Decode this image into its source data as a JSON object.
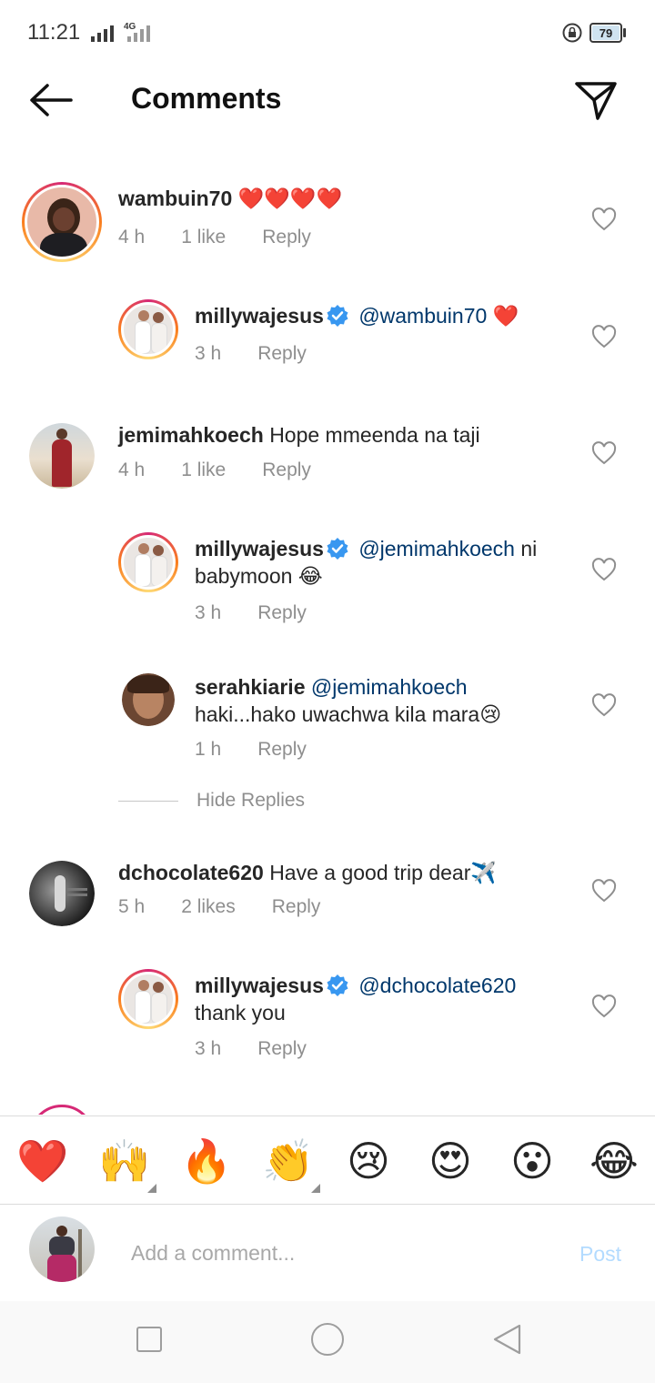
{
  "status_bar": {
    "time": "11:21",
    "network": "4G",
    "battery": "79",
    "icons": [
      "signal-icon",
      "signal-4g-icon",
      "rotation-lock-icon",
      "battery-icon"
    ]
  },
  "header": {
    "title": "Comments",
    "back_icon": "arrow-left-icon",
    "share_icon": "paper-plane-icon"
  },
  "comments": [
    {
      "username": "wambuin70",
      "text": "❤️❤️❤️❤️",
      "mention": "",
      "time": "4 h",
      "likes": "1 like",
      "reply_label": "Reply",
      "verified": false,
      "is_reply": false
    },
    {
      "username": "millywajesus",
      "mention": "@wambuin70",
      "text": "❤️",
      "time": "3 h",
      "likes": "",
      "reply_label": "Reply",
      "verified": true,
      "is_reply": true
    },
    {
      "username": "jemimahkoech",
      "text": "Hope mmeenda na taji",
      "mention": "",
      "time": "4 h",
      "likes": "1 like",
      "reply_label": "Reply",
      "verified": false,
      "is_reply": false
    },
    {
      "username": "millywajesus",
      "mention": "@jemimahkoech",
      "text": "ni babymoon 😂",
      "time": "3 h",
      "likes": "",
      "reply_label": "Reply",
      "verified": true,
      "is_reply": true
    },
    {
      "username": "serahkiarie",
      "mention": "@jemimahkoech",
      "text": "haki...hako uwachwa kila mara😢",
      "time": "1 h",
      "likes": "",
      "reply_label": "Reply",
      "verified": false,
      "is_reply": true
    },
    {
      "username": "dchocolate620",
      "text": "Have a good trip dear✈️",
      "mention": "",
      "time": "5 h",
      "likes": "2 likes",
      "reply_label": "Reply",
      "verified": false,
      "is_reply": false
    },
    {
      "username": "millywajesus",
      "mention": "@dchocolate620",
      "text": "thank you",
      "time": "3 h",
      "likes": "",
      "reply_label": "Reply",
      "verified": true,
      "is_reply": true
    }
  ],
  "hide_replies_label": "Hide Replies",
  "emoji_bar": [
    "❤️",
    "🙌",
    "🔥",
    "👏",
    "😢",
    "😍",
    "😮",
    "😂"
  ],
  "composer": {
    "placeholder": "Add a comment...",
    "post_label": "Post"
  },
  "colors": {
    "mention": "#00376b",
    "meta": "#8e8e8e",
    "post_disabled": "#b3dbff",
    "verified": "#3897f0",
    "story_ring": "#d62976"
  }
}
